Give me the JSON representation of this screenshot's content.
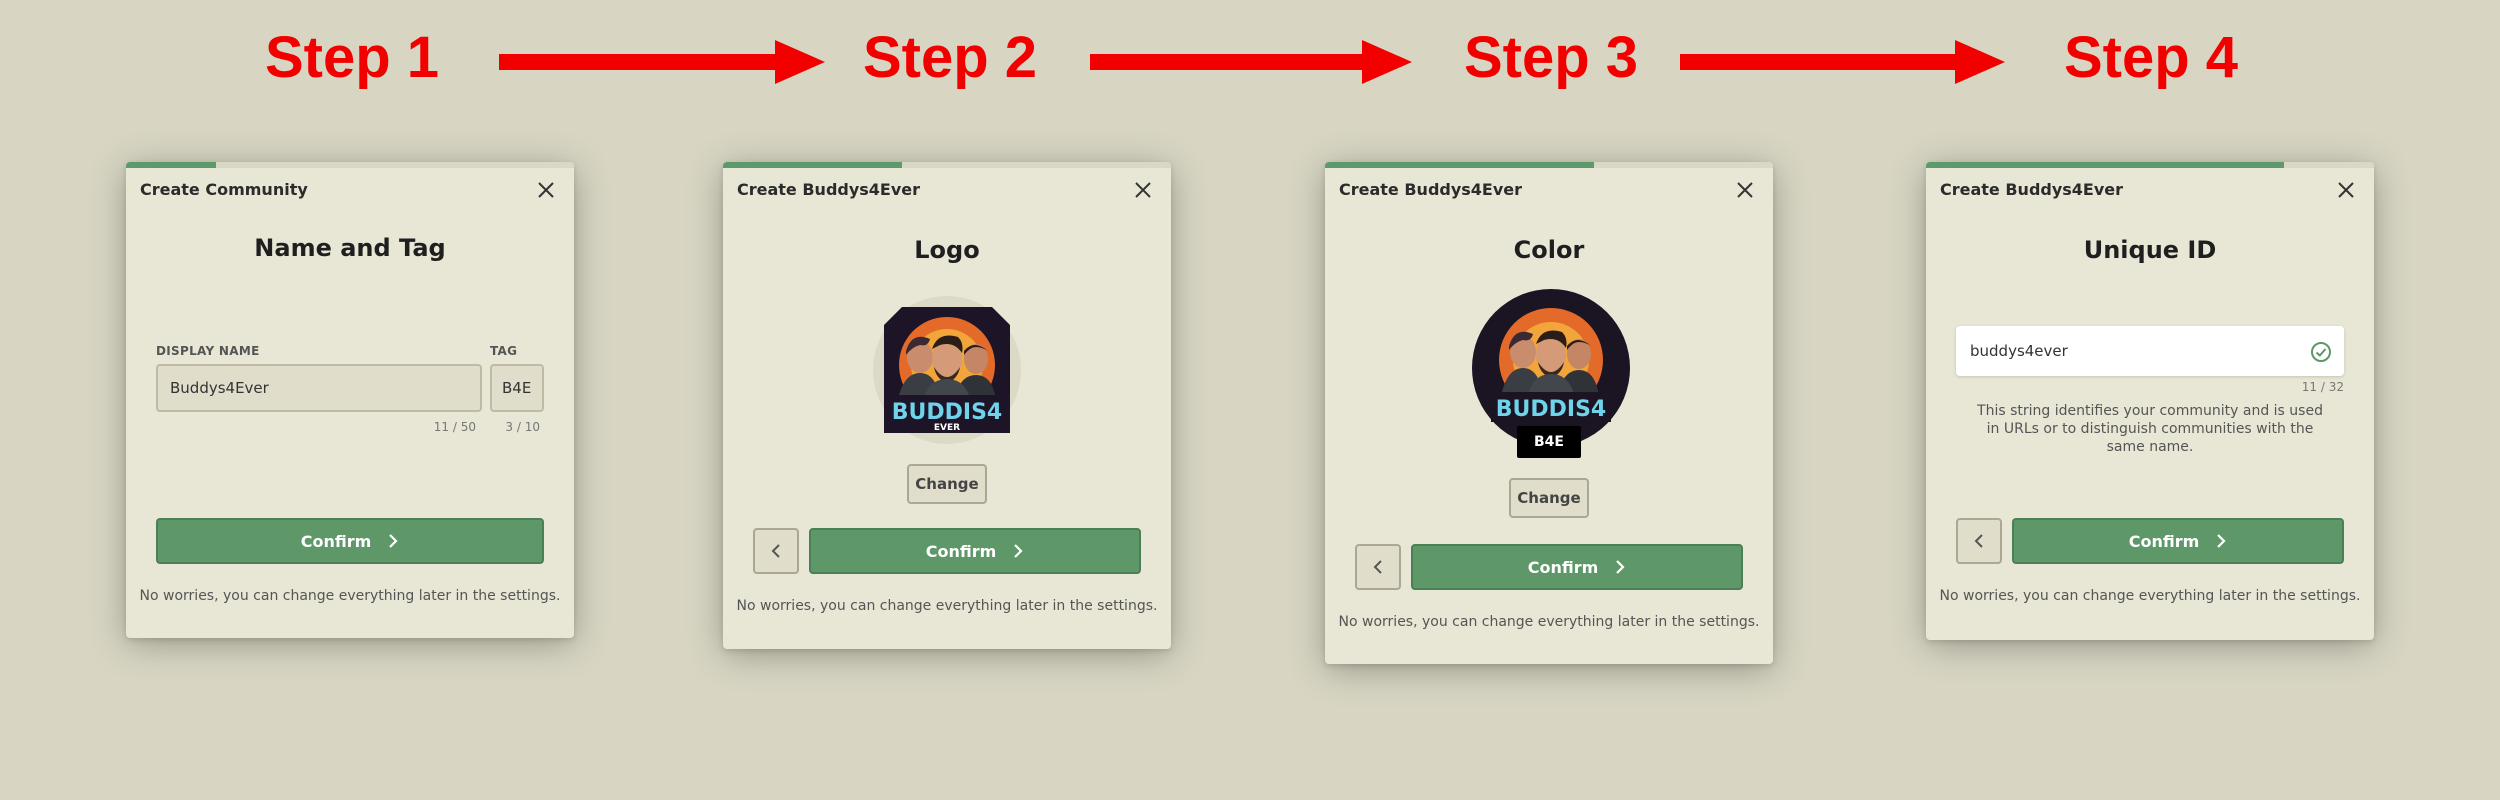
{
  "steps": [
    {
      "label": "Step 1"
    },
    {
      "label": "Step 2"
    },
    {
      "label": "Step 3"
    },
    {
      "label": "Step 4"
    }
  ],
  "colors": {
    "accent": "#5e9768",
    "arrow": "#f20000",
    "background": "#d8d6c3",
    "dialog": "#e8e6d5"
  },
  "dialog1": {
    "header": "Create Community",
    "title": "Name and Tag",
    "progress": 0.2,
    "display_name_label": "DISPLAY NAME",
    "display_name_value": "Buddys4Ever",
    "display_name_counter": "11 / 50",
    "tag_label": "TAG",
    "tag_value": "B4E",
    "tag_counter": "3 / 10",
    "confirm": "Confirm",
    "note": "No worries, you can change everything later in the settings."
  },
  "dialog2": {
    "header": "Create Buddys4Ever",
    "title": "Logo",
    "progress": 0.4,
    "logo_text": "BUDDIS4",
    "logo_subtext": "EVER",
    "change": "Change",
    "confirm": "Confirm",
    "note": "No worries, you can change everything later in the settings."
  },
  "dialog3": {
    "header": "Create Buddys4Ever",
    "title": "Color",
    "progress": 0.6,
    "logo_text": "BUDDIS4",
    "tag_badge": "B4E",
    "change": "Change",
    "confirm": "Confirm",
    "note": "No worries, you can change everything later in the settings."
  },
  "dialog4": {
    "header": "Create Buddys4Ever",
    "title": "Unique ID",
    "progress": 0.8,
    "id_value": "buddys4ever",
    "id_counter": "11 / 32",
    "help": "This string identifies your community and is used in URLs or to distinguish communities with the same name.",
    "confirm": "Confirm",
    "note": "No worries, you can change everything later in the settings."
  }
}
